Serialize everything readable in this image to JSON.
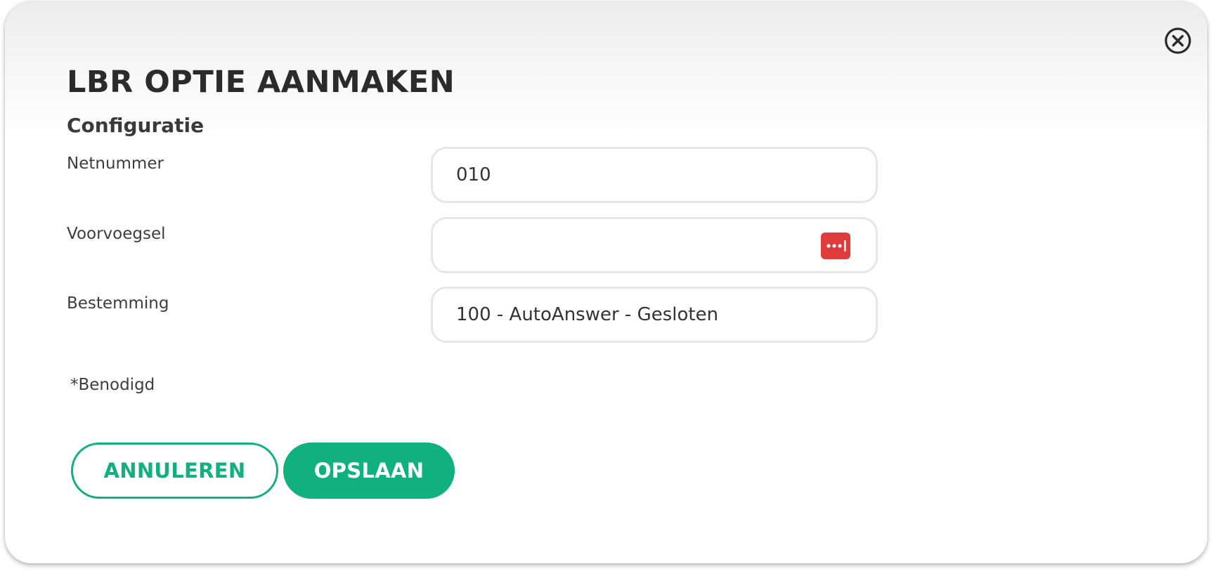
{
  "dialog": {
    "title": "LBR OPTIE AANMAKEN",
    "section_title": "Configuratie",
    "close_icon": "close-circle-icon"
  },
  "fields": {
    "netnummer": {
      "label": "Netnummer",
      "value": "010"
    },
    "voorvoegsel": {
      "label": "Voorvoegsel",
      "value": "",
      "badge_icon": "password-manager-icon",
      "badge_color": "#e03b3b"
    },
    "bestemming": {
      "label": "Bestemming",
      "value": "100 - AutoAnswer - Gesloten"
    }
  },
  "required_note": "*Benodigd",
  "buttons": {
    "cancel_label": "ANNULEREN",
    "save_label": "OPSLAAN",
    "accent_color": "#10b07f"
  }
}
